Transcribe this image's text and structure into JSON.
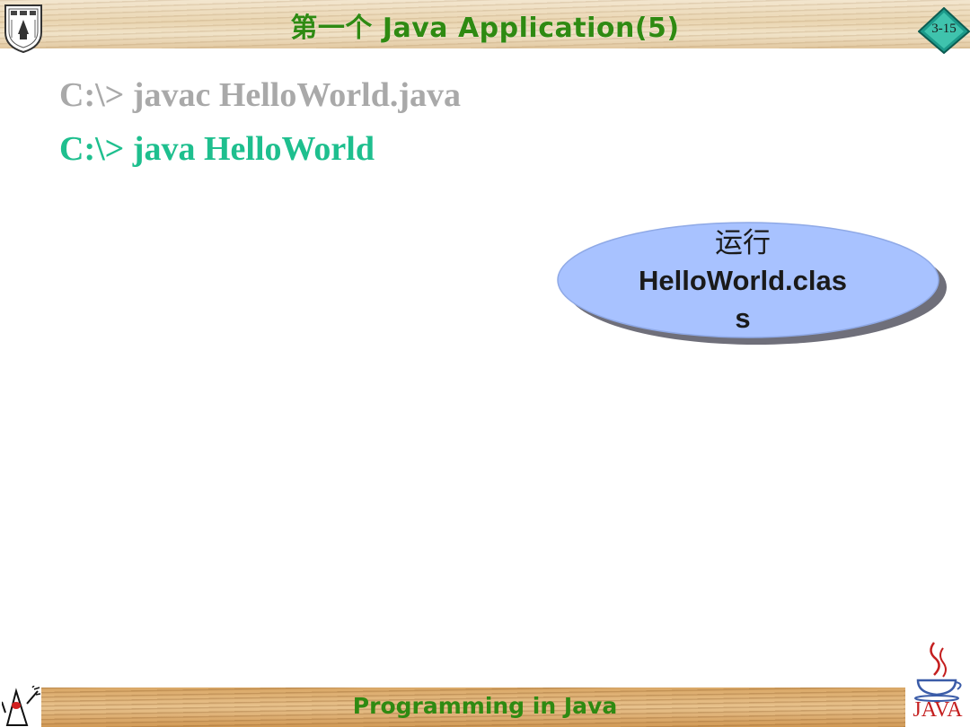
{
  "header": {
    "title": "第一个 Java Application(5)",
    "page_number": "3-15",
    "logo_icon": "university-crest-icon"
  },
  "content": {
    "command_1": "C:\\> javac HelloWorld.java",
    "command_2": "C:\\> java HelloWorld",
    "callout": {
      "line_1": "运行",
      "line_2": "HelloWorld.clas",
      "line_3": "s"
    }
  },
  "footer": {
    "text": "Programming in Java",
    "left_icon": "duke-mascot-icon",
    "right_icon": "java-coffee-cup-icon",
    "java_logo_text": "JAVA"
  },
  "colors": {
    "title_green": "#2f8a12",
    "command_gray": "#a9a9a9",
    "command_teal": "#1ebf8e",
    "callout_fill": "#a8c2ff",
    "java_red": "#c41f1f"
  }
}
